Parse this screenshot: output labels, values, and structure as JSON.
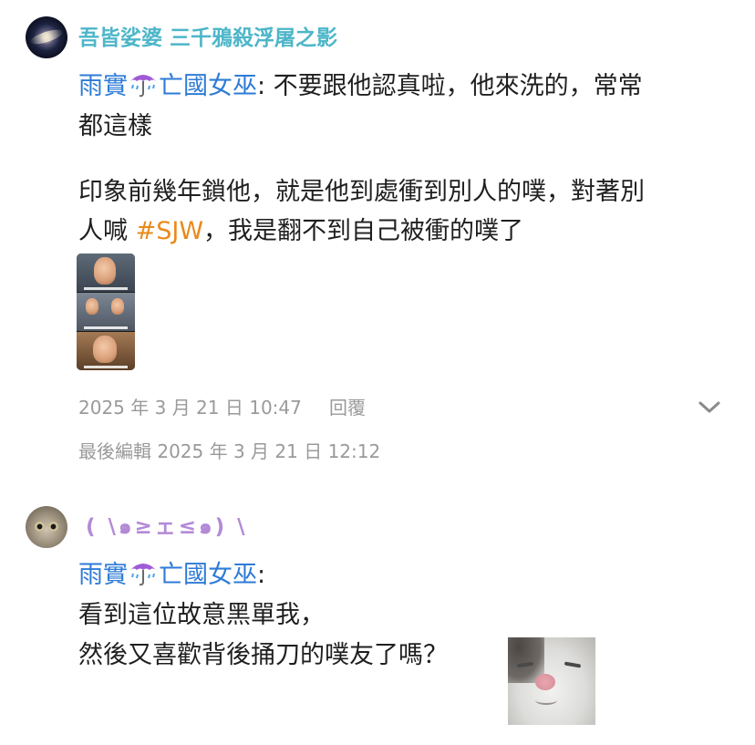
{
  "comments": [
    {
      "avatar_icon": "galaxy-avatar",
      "username": "吾皆娑婆 三千鴉殺浮屠之影",
      "mention": "雨實",
      "mention_suffix": "亡國女巫",
      "mention_emoji": "umbrella-with-rain-icon",
      "text_line1": ": 不要跟他認真啦，他來洗的，常常",
      "text_line2": "都這樣",
      "text_line3": "印象前幾年鎖他，就是他到處衝到別人的噗，對著別",
      "text_line4_before": "人喊 ",
      "hashtag": "#SJW",
      "text_line4_after": "，我是翻不到自己被衝的噗了",
      "attachment": "meme-image",
      "timestamp": "2025 年 3 月 21 日 10:47",
      "reply_label": "回覆",
      "edited": "最後編輯 2025 年 3 月 21 日 12:12"
    },
    {
      "avatar_icon": "owl-avatar",
      "username": "( \\๑≥ェ≤๑) \\",
      "mention": "雨實",
      "mention_suffix": "亡國女巫",
      "mention_emoji": "umbrella-with-rain-icon",
      "text_line1": ":",
      "text_line2": "看到這位故意黑單我，",
      "text_line3": "然後又喜歡背後捅刀的噗友了嗎？",
      "attachment": "cat-sticker-image"
    }
  ],
  "colors": {
    "username1": "#4db6c9",
    "username2": "#b38ad6",
    "mention": "#2e7bd6",
    "hashtag": "#e98a1c",
    "meta": "#9a9a9a"
  }
}
